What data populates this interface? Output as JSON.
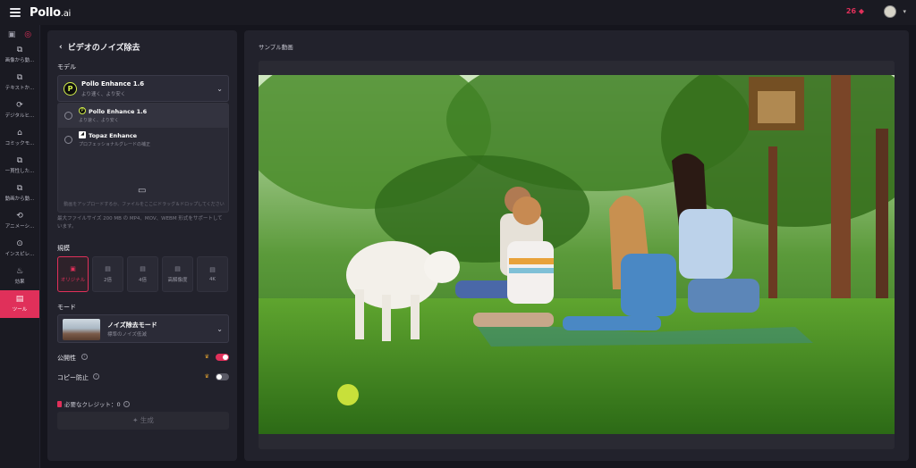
{
  "app": {
    "logo_main": "Pollo",
    "logo_suffix": ".ai",
    "credits": "26 ",
    "credit_symbol": "◆"
  },
  "sidebar": {
    "items": [
      {
        "label": "画像から動...",
        "icon": "image-video-icon"
      },
      {
        "label": "テキストか...",
        "icon": "text-video-icon"
      },
      {
        "label": "デジタルヒ...",
        "icon": "digital-human-icon"
      },
      {
        "label": "コミックモ...",
        "icon": "comic-icon"
      },
      {
        "label": "一貫性した...",
        "icon": "consistent-icon"
      },
      {
        "label": "動画から動...",
        "icon": "video-video-icon"
      },
      {
        "label": "アニメーシ...",
        "icon": "animation-icon"
      },
      {
        "label": "インスピレ...",
        "icon": "inspiration-icon"
      },
      {
        "label": "効果",
        "icon": "effects-icon"
      },
      {
        "label": "ツール",
        "icon": "tools-icon"
      }
    ]
  },
  "left": {
    "title": "ビデオのノイズ除去",
    "model_label": "モデル",
    "selected_model": {
      "name": "Pollo Enhance 1.6",
      "sub": "より速く、より安く"
    },
    "models": [
      {
        "name": "Pollo Enhance 1.6",
        "sub": "より速く、より安く"
      },
      {
        "name": "Topaz Enhance",
        "sub": "プロフェッショナルグレードの補正"
      }
    ],
    "upload_text": "動画をアップロードするか、ファイルをここにドラッグ＆ドロップしてください",
    "file_note": "最大ファイルサイズ 200 MB の MP4、MOV、WEBM 形式をサポートしています。",
    "scale_label": "規模",
    "scales": [
      "オリジナル",
      "2倍",
      "4倍",
      "高解像度",
      "4K"
    ],
    "mode_label": "モード",
    "mode": {
      "name": "ノイズ除去モード",
      "sub": "標準のノイズ低減"
    },
    "public_label": "公開性",
    "public_on": true,
    "copy_label": "コピー防止",
    "copy_on": false,
    "credit_required": "必要なクレジット：0",
    "generate_label": "生成"
  },
  "right": {
    "title": "サンプル動画"
  },
  "colors": {
    "accent": "#e0305a",
    "panel": "#22222c",
    "background": "#15151d"
  }
}
